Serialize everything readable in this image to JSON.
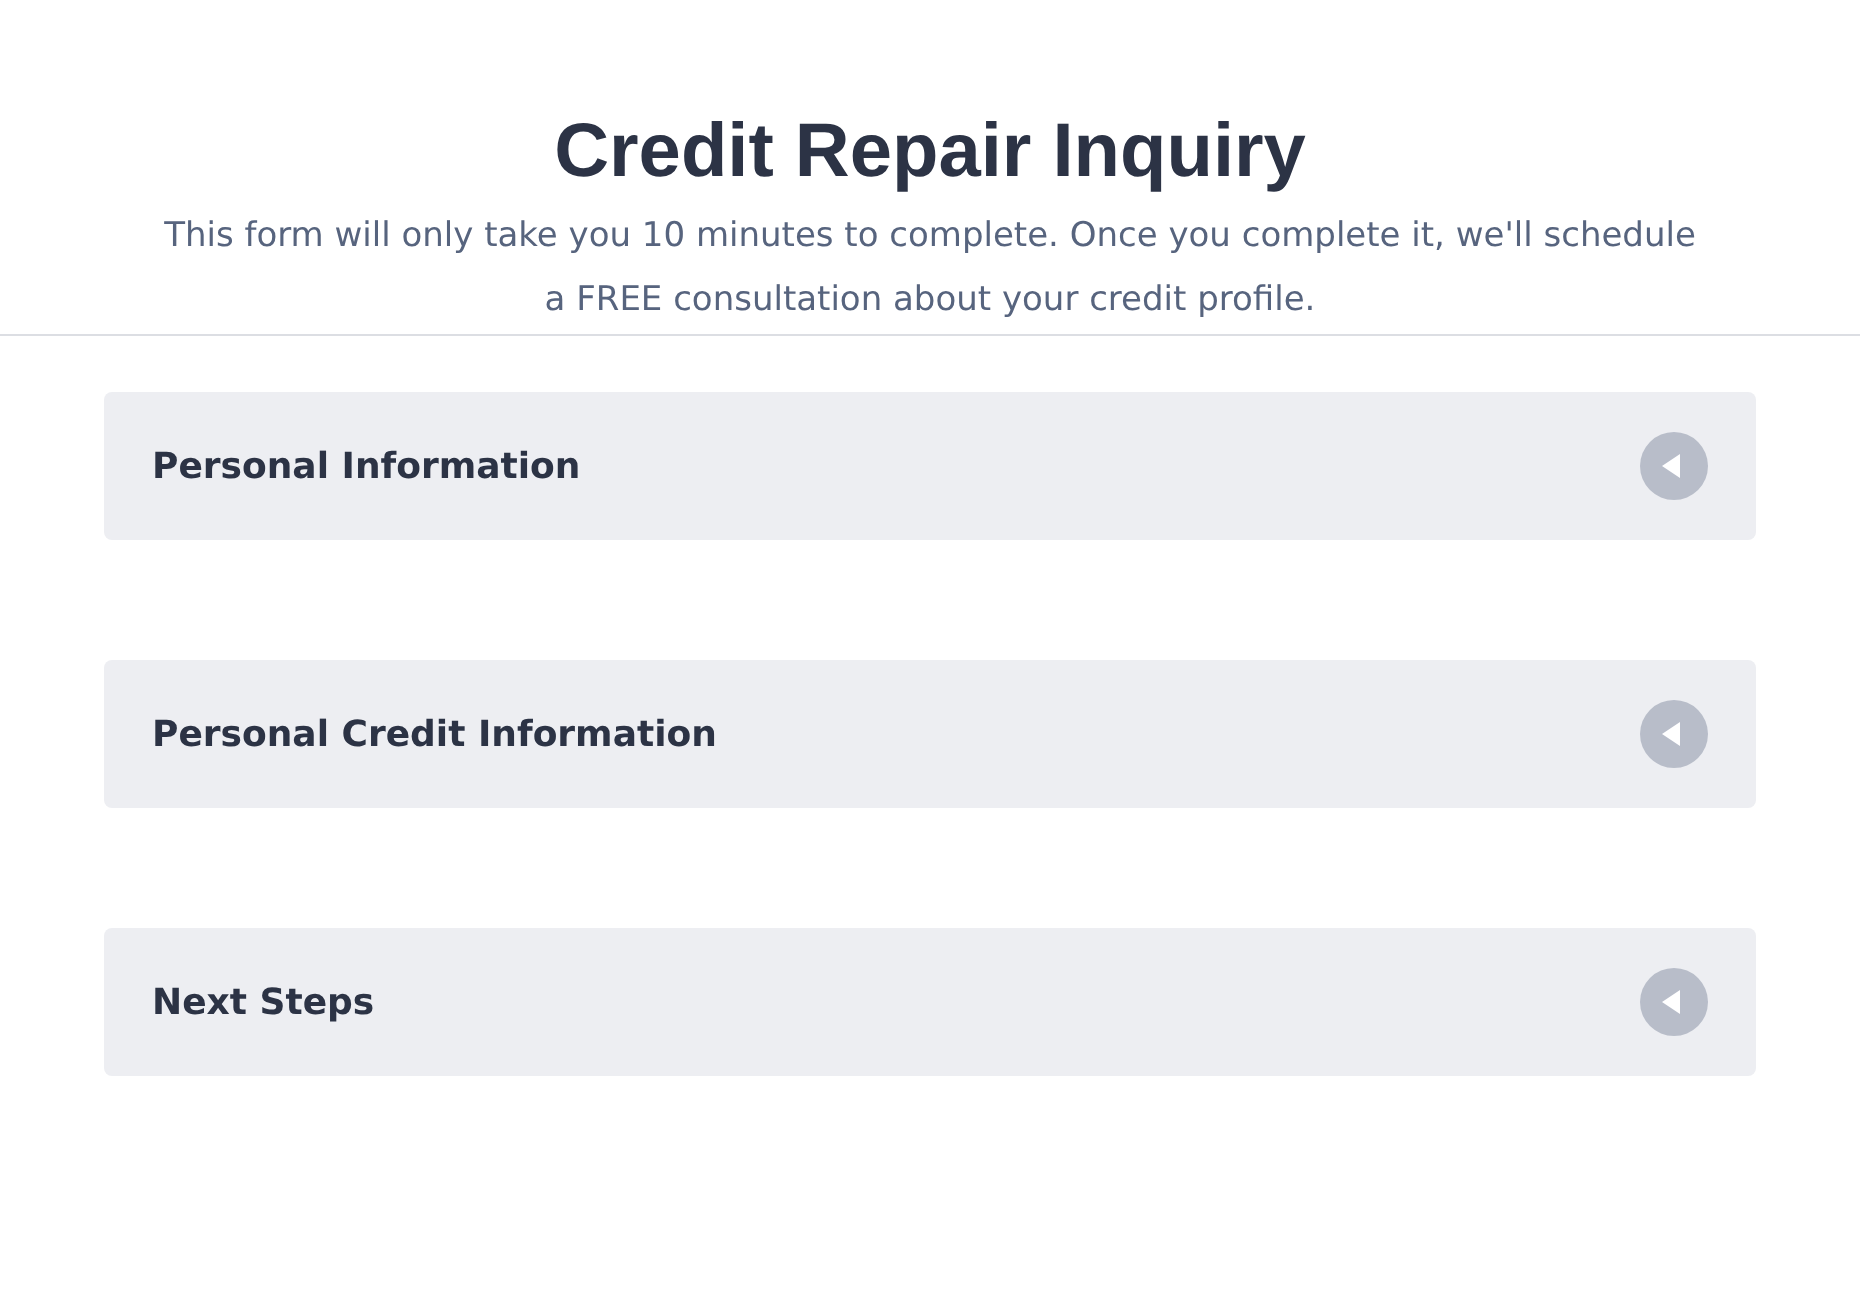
{
  "header": {
    "title": "Credit Repair Inquiry",
    "subtitle": "This form will only take you 10 minutes to complete. Once you complete it, we'll schedule a FREE consultation about your credit profile."
  },
  "sections": [
    {
      "label": "Personal Information",
      "expanded": false
    },
    {
      "label": "Personal Credit Information",
      "expanded": false
    },
    {
      "label": "Next Steps",
      "expanded": false
    }
  ]
}
